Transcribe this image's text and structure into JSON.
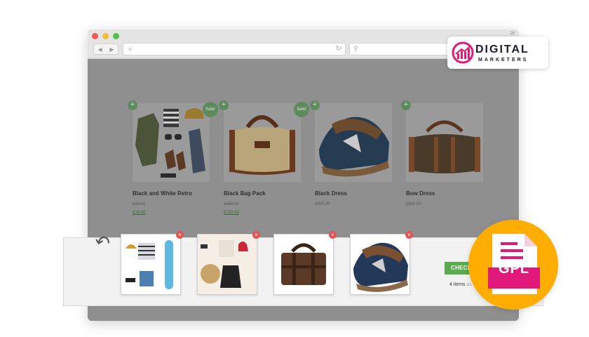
{
  "logo": {
    "line1": "DIGITAL",
    "line2": "MARKETERS"
  },
  "browser": {
    "window_id": "28",
    "url_placeholder": "+"
  },
  "products": [
    {
      "name": "Black and White Retro",
      "old_price": "£20.00",
      "price": "£15.00",
      "badge": "Sale!"
    },
    {
      "name": "Black Bag Pack",
      "old_price": "£250.00",
      "price": "£233.00",
      "badge": "Sale!"
    },
    {
      "name": "Black Dress",
      "price": "£300.00"
    },
    {
      "name": "Bow Dress",
      "price": "£600.00"
    }
  ],
  "cart": {
    "checkout_label": "CHECK",
    "items_count": "4 items",
    "items_sub": "(£1"
  },
  "badge": {
    "label": "GPL"
  },
  "colors": {
    "accent_green": "#5aab4e",
    "gpl_orange": "#ffae00",
    "remove_red": "#e05555",
    "brand_magenta": "#e0197a"
  }
}
